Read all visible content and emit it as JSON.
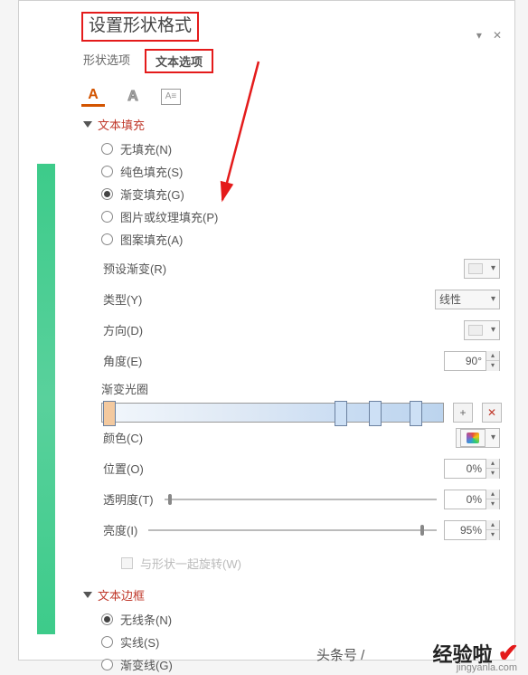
{
  "panel": {
    "title": "设置形状格式",
    "tabs": {
      "shape": "形状选项",
      "text": "文本选项"
    }
  },
  "sections": {
    "text_fill": "文本填充",
    "text_outline": "文本边框"
  },
  "fill_options": {
    "none": "无填充(N)",
    "solid": "纯色填充(S)",
    "gradient": "渐变填充(G)",
    "picture": "图片或纹理填充(P)",
    "pattern": "图案填充(A)"
  },
  "props": {
    "preset": {
      "label": "预设渐变(R)"
    },
    "type": {
      "label": "类型(Y)",
      "value": "线性"
    },
    "direction": {
      "label": "方向(D)"
    },
    "angle": {
      "label": "角度(E)",
      "value": "90°"
    },
    "stops_label": "渐变光圈",
    "color": {
      "label": "颜色(C)"
    },
    "position": {
      "label": "位置(O)",
      "value": "0%"
    },
    "transparency": {
      "label": "透明度(T)",
      "value": "0%"
    },
    "brightness": {
      "label": "亮度(I)",
      "value": "95%"
    },
    "rotate_with_shape": "与形状一起旋转(W)"
  },
  "outline_options": {
    "none": "无线条(N)",
    "solid": "实线(S)",
    "gradient": "渐变线(G)"
  },
  "watermark": {
    "brand": "经验啦",
    "url": "jingyanla.com",
    "byline": "头条号 /"
  }
}
